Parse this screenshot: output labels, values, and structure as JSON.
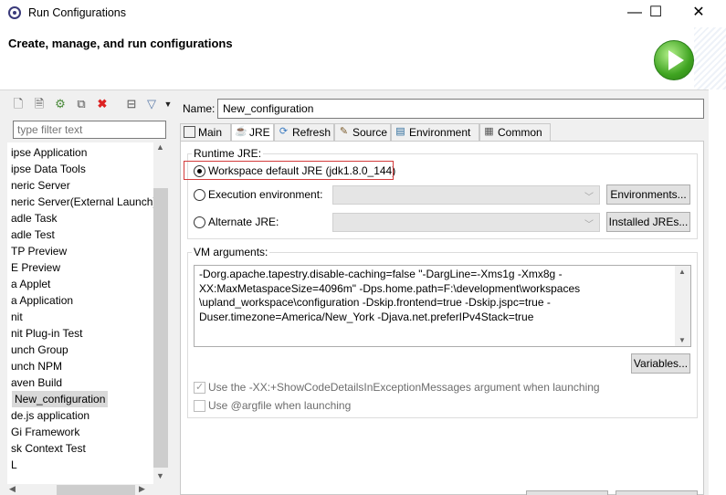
{
  "window": {
    "title": "Run Configurations",
    "minimize": "—",
    "maximize": "☐",
    "close": "✕"
  },
  "header": {
    "title": "Create, manage, and run configurations"
  },
  "left": {
    "filter_placeholder": "type filter text",
    "tree_items": [
      "ipse Application",
      "ipse Data Tools",
      "neric Server",
      "neric Server(External Launch)",
      "adle Task",
      "adle Test",
      "TP Preview",
      "E Preview",
      "a Applet",
      "a Application",
      "nit",
      "nit Plug-in Test",
      "unch Group",
      "unch NPM",
      "aven Build",
      "New_configuration",
      "de.js application",
      "Gi Framework",
      "sk Context Test",
      "L"
    ],
    "selected": "New_configuration"
  },
  "main": {
    "name_label": "Name:",
    "name_value": "New_configuration",
    "tabs": [
      {
        "label": "Main",
        "icon": "main-tab-icon"
      },
      {
        "label": "JRE",
        "icon": "jre-tab-icon"
      },
      {
        "label": "Refresh",
        "icon": "refresh-tab-icon"
      },
      {
        "label": "Source",
        "icon": "source-tab-icon"
      },
      {
        "label": "Environment",
        "icon": "environment-tab-icon"
      },
      {
        "label": "Common",
        "icon": "common-tab-icon"
      }
    ],
    "active_tab": "JRE",
    "runtime_jre": {
      "group_label": "Runtime JRE:",
      "workspace_default": "Workspace default JRE (jdk1.8.0_144)",
      "execution_env": "Execution environment:",
      "alternate": "Alternate JRE:",
      "environments_button": "Environments...",
      "installed_button": "Installed JREs..."
    },
    "vm_args": {
      "group_label": "VM arguments:",
      "text": "-Dorg.apache.tapestry.disable-caching=false \"-DargLine=-Xms1g -Xmx8g -\nXX:MaxMetaspaceSize=4096m\" -Dps.home.path=F:\\development\\workspaces\n\\upland_workspace\\configuration -Dskip.frontend=true -Dskip.jspc=true -\nDuser.timezone=America/New_York -Djava.net.preferIPv4Stack=true",
      "variables_button": "Variables...",
      "show_code_details": "Use the -XX:+ShowCodeDetailsInExceptionMessages argument when launching",
      "use_argfile": "Use @argfile when launching"
    }
  },
  "colors": {
    "highlight_border": "#d23a3a",
    "run_button": "#3fa421"
  }
}
